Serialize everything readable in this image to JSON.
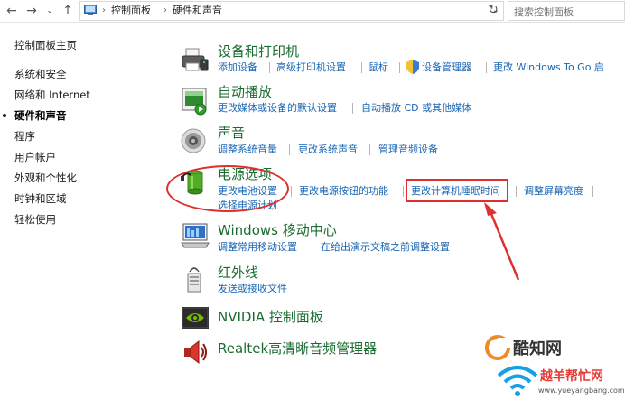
{
  "address_bar": {
    "breadcrumb": [
      "控制面板",
      "硬件和声音"
    ],
    "search_placeholder": "搜索控制面板"
  },
  "sidebar": {
    "items": [
      {
        "label": "控制面板主页",
        "active": false
      },
      {
        "label": "系统和安全",
        "active": false
      },
      {
        "label": "网络和 Internet",
        "active": false
      },
      {
        "label": "硬件和声音",
        "active": true
      },
      {
        "label": "程序",
        "active": false
      },
      {
        "label": "用户帐户",
        "active": false
      },
      {
        "label": "外观和个性化",
        "active": false
      },
      {
        "label": "时钟和区域",
        "active": false
      },
      {
        "label": "轻松使用",
        "active": false
      }
    ]
  },
  "categories": [
    {
      "title": "设备和打印机",
      "icon": "printer-icon",
      "links": [
        "添加设备",
        "高级打印机设置",
        "鼠标",
        "设备管理器",
        "更改 Windows To Go 启"
      ]
    },
    {
      "title": "自动播放",
      "icon": "autoplay-icon",
      "links": [
        "更改媒体或设备的默认设置",
        "自动播放 CD 或其他媒体"
      ]
    },
    {
      "title": "声音",
      "icon": "speaker-icon",
      "links": [
        "调整系统音量",
        "更改系统声音",
        "管理音频设备"
      ]
    },
    {
      "title": "电源选项",
      "icon": "battery-icon",
      "links": [
        "更改电池设置",
        "更改电源按钮的功能",
        "更改计算机睡眠时间",
        "调整屏幕亮度",
        "选择电源计划"
      ]
    },
    {
      "title": "Windows 移动中心",
      "icon": "mobility-center-icon",
      "links": [
        "调整常用移动设置",
        "在给出演示文稿之前调整设置"
      ]
    },
    {
      "title": "红外线",
      "icon": "infrared-icon",
      "links": [
        "发送或接收文件"
      ]
    },
    {
      "title": "NVIDIA 控制面板",
      "icon": "nvidia-icon",
      "links": []
    },
    {
      "title": "Realtek高清晰音频管理器",
      "icon": "realtek-speaker-icon",
      "links": []
    }
  ],
  "watermark": {
    "brand_top": "酷知网",
    "brand_bottom": "越羊帮忙网",
    "url": "www.yueyangbang.com"
  },
  "colors": {
    "link": "#1a66b4",
    "title": "#1a6b30",
    "annotation": "#e0302d"
  }
}
